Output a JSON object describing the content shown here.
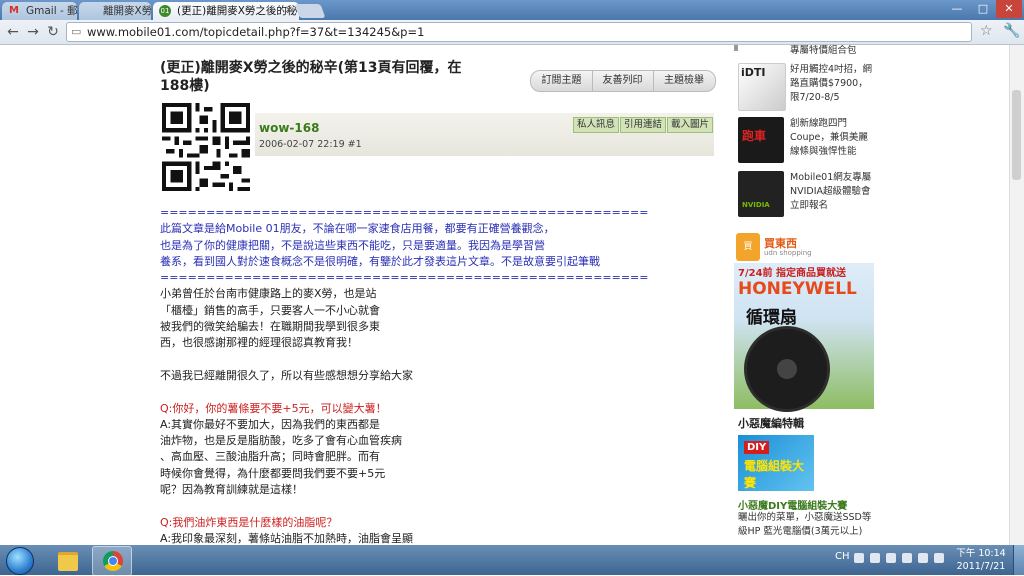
{
  "browser": {
    "tabs": [
      {
        "label": "Gmail - 郵寄",
        "favicon": "M"
      },
      {
        "label": "離開麥X勞",
        "favicon": ""
      },
      {
        "label": "(更正)離開麥X勞之後的秘辛",
        "favicon": "01"
      }
    ],
    "url": "www.mobile01.com/topicdetail.php?f=37&t=134245&p=1"
  },
  "post": {
    "title": "(更正)離開麥X勞之後的秘辛(第13頁有回覆，在188樓)",
    "actions": [
      "訂閱主題",
      "友善列印",
      "主題檢舉"
    ],
    "author": "wow-168",
    "date": "2006-02-07 22:19",
    "floor": "#1",
    "author_actions": [
      "私人訊息",
      "引用連結",
      "載入圖片"
    ],
    "lines": [
      {
        "text": "=====================================================",
        "color": "blue"
      },
      {
        "text": "此篇文章是給Mobile 01朋友，不論在哪一家速食店用餐，都要有正確營養觀念，",
        "color": "blue"
      },
      {
        "text": "也是為了你的健康把關，不是說這些東西不能吃，只是要適量。我因為是學習營",
        "color": "blue"
      },
      {
        "text": "養系，看到國人對於速食概念不是很明確，有鑒於此才發表這片文章。不是故意要引起筆戰",
        "color": "blue"
      },
      {
        "text": "=====================================================",
        "color": "blue"
      },
      {
        "text": "小弟曾任於台南市健康路上的麥X勞，也是站",
        "color": ""
      },
      {
        "text": "「櫃檯」銷售的高手，只要客人一不小心就會",
        "color": ""
      },
      {
        "text": "被我們的微笑給騙去！在職期間我學到很多東",
        "color": ""
      },
      {
        "text": "西，也很感謝那裡的經理很認真教育我！",
        "color": ""
      },
      {
        "text": "",
        "color": ""
      },
      {
        "text": "不過我已經離開很久了，所以有些感想想分享給大家",
        "color": ""
      },
      {
        "text": "",
        "color": ""
      },
      {
        "text": "Q:你好，你的薯條要不要+5元，可以變大薯！",
        "color": "red"
      },
      {
        "text": "A:其實你最好不要加大，因為我們的東西都是",
        "color": ""
      },
      {
        "text": "油炸物，也是反是脂肪酸，吃多了會有心血管疾病",
        "color": ""
      },
      {
        "text": "、高血壓、三酸油脂升高；同時會肥胖。而有",
        "color": ""
      },
      {
        "text": "時候你會覺得，為什麼都要問我們要不要+5元",
        "color": ""
      },
      {
        "text": "呢？因為教育訓練就是這樣！",
        "color": ""
      },
      {
        "text": "",
        "color": ""
      },
      {
        "text": "Q:我們油炸東西是什麼樣的油脂呢？",
        "color": "red"
      },
      {
        "text": "A:我印象最深刻，薯條站油脂不加熱時，油脂會呈顯",
        "color": ""
      }
    ]
  },
  "sidebar": {
    "top_partial": "專屬特價組合包",
    "items": [
      {
        "text": "好用觸控4吋招，網路直購價$7900，限7/20-8/5",
        "thumb": "dti",
        "thumb_label": "iDTI"
      },
      {
        "text": "創新線跑四門Coupe，兼俱美麗線條與強悍性能",
        "thumb": "car",
        "thumb_label": "跑車"
      },
      {
        "text": "Mobile01網友專屬NVIDIA超級體驗會立即報名",
        "thumb": "nvidia",
        "thumb_label": "NVIDIA"
      }
    ],
    "ad": {
      "brand": "買東西",
      "brand_sub": "udn shopping",
      "slogan": "7/24前 指定商品買就送",
      "headline": "HONEYWELL",
      "subline": "循環扇"
    },
    "section_title": "小惡魔編特輯",
    "diy": {
      "tag": "DIY",
      "image_text": "電腦組裝大賽",
      "link": "小惡魔DIY電腦組裝大賽",
      "desc": "曬出你的菜單，小惡魔送SSD等級HP 藍光電腦價(3萬元以上)"
    }
  },
  "taskbar": {
    "lang": "CH",
    "time": "下午 10:14",
    "date": "2011/7/21"
  },
  "colors": {
    "blue_text": "#2a2fb3",
    "red_text": "#cc1f1f",
    "author_green": "#3a7a1c"
  }
}
